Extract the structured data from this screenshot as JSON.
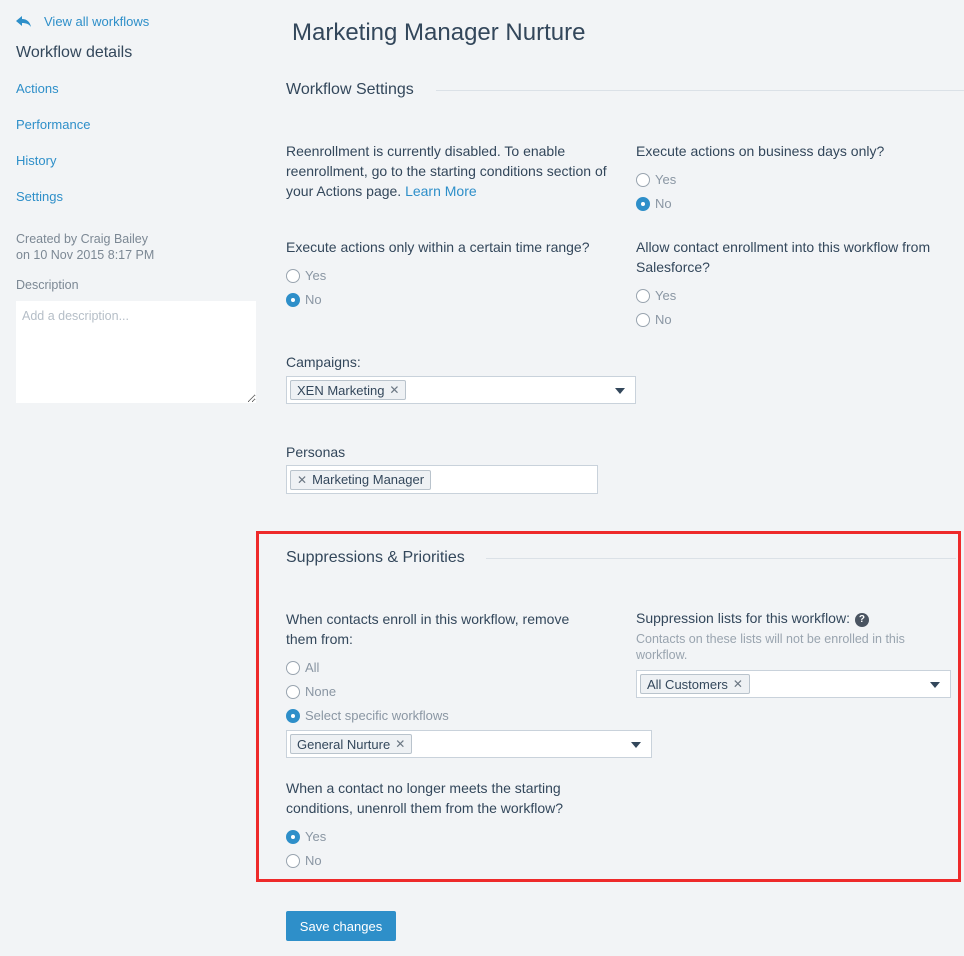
{
  "sidebar": {
    "back_label": "View all workflows",
    "title": "Workflow details",
    "nav": [
      "Actions",
      "Performance",
      "History",
      "Settings"
    ],
    "created_line1": "Created by Craig Bailey",
    "created_line2": "on 10 Nov 2015 8:17 PM",
    "description_label": "Description",
    "description_placeholder": "Add a description..."
  },
  "main": {
    "title": "Marketing Manager Nurture",
    "workflow_settings": {
      "heading": "Workflow Settings",
      "reenroll_text": "Reenrollment is currently disabled. To enable reenrollment, go to the starting conditions section of your Actions page.",
      "learn_more": "Learn More",
      "business_days": {
        "question": "Execute actions on business days only?",
        "options": [
          "Yes",
          "No"
        ],
        "selected": "No"
      },
      "time_range": {
        "question": "Execute actions only within a certain time range?",
        "options": [
          "Yes",
          "No"
        ],
        "selected": "No"
      },
      "salesforce": {
        "question": "Allow contact enrollment into this workflow from Salesforce?",
        "options": [
          "Yes",
          "No"
        ],
        "selected": ""
      },
      "campaigns": {
        "label": "Campaigns:",
        "tags": [
          "XEN Marketing"
        ]
      },
      "personas": {
        "label": "Personas",
        "tags": [
          "Marketing Manager"
        ]
      }
    },
    "suppressions": {
      "heading": "Suppressions & Priorities",
      "remove_question": "When contacts enroll in this workflow, remove them from:",
      "remove_options": [
        "All",
        "None",
        "Select specific workflows"
      ],
      "remove_selected": "Select specific workflows",
      "workflow_tags": [
        "General Nurture"
      ],
      "lists_label": "Suppression lists for this workflow:",
      "lists_help": "Contacts on these lists will not be enrolled in this workflow.",
      "list_tags": [
        "All Customers"
      ],
      "unenroll_question": "When a contact no longer meets the starting conditions, unenroll them from the workflow?",
      "unenroll_options": [
        "Yes",
        "No"
      ],
      "unenroll_selected": "Yes"
    },
    "save_label": "Save changes"
  },
  "icons": {
    "back": "back-arrow-icon",
    "caret": "chevron-down-icon",
    "remove": "close-icon",
    "help": "question-mark-icon"
  },
  "colors": {
    "accent": "#2e8fc9",
    "highlight": "#ee2a2a",
    "background": "#f2f4f6",
    "text": "#33475b"
  }
}
